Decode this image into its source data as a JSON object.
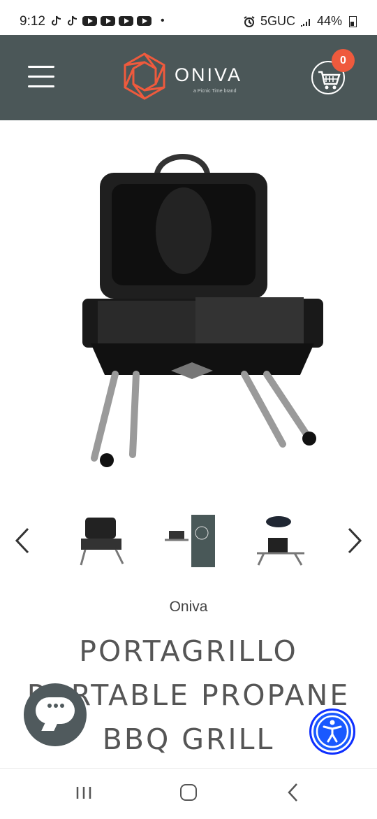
{
  "status_bar": {
    "time": "9:12",
    "network": "5GUC",
    "battery": "44%",
    "notifications": [
      "tiktok-icon",
      "tiktok-icon",
      "youtube-icon",
      "youtube-icon",
      "youtube-icon",
      "youtube-icon"
    ],
    "dot": "•"
  },
  "header": {
    "brand": "ONIVA",
    "subtitle": "a Picnic Time brand",
    "cart_count": "0",
    "accent_color": "#ef5a3d"
  },
  "product": {
    "brand": "Oniva",
    "title_lines": [
      "PORTAGRILLO",
      "PORTABLE PROPANE",
      "BBQ GRILL"
    ],
    "thumbnails": [
      "grill-open-thumbnail",
      "grill-box-thumbnail",
      "grill-folded-thumbnail"
    ]
  }
}
